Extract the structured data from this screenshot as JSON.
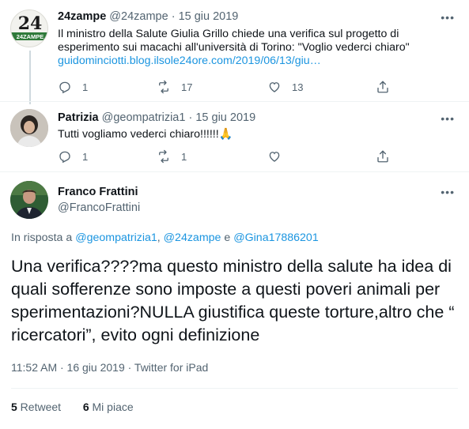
{
  "tweets": [
    {
      "name": "24zampe",
      "handle": "@24zampe",
      "dot": "·",
      "date": "15 giu 2019",
      "text": "Il ministro della Salute Giulia Grillo chiede una verifica sul progetto di esperimento sui macachi all'università di Torino: \"Voglio vederci chiaro\"",
      "link": "guidominciotti.blog.ilsole24ore.com/2019/06/13/giu…",
      "avatar_text": "24ZAMPE",
      "replies": "1",
      "retweets": "17",
      "likes": "13"
    },
    {
      "name": "Patrizia",
      "handle": "@geompatrizia1",
      "dot": "·",
      "date": "15 giu 2019",
      "text": "Tutti vogliamo vederci chiaro!!!!!!🙏",
      "replies": "1",
      "retweets": "1",
      "likes": ""
    }
  ],
  "main": {
    "name": "Franco Frattini",
    "handle": "@FrancoFrattini",
    "reply_prefix": "In risposta a ",
    "mention1": "@geompatrizia1",
    "mention_sep": ", ",
    "mention2": "@24zampe",
    "mention_and": " e ",
    "mention3": "@Gina17886201",
    "text": "Una verifica????ma questo ministro della salute ha idea di quali sofferenze sono imposte a questi poveri animali per sperimentazioni?NULLA giustifica queste torture,altro che “ ricercatori”, evito ogni definizione",
    "meta": "11:52 AM · 16 giu 2019 · Twitter for iPad",
    "retweet_count": "5",
    "retweet_label": " Retweet",
    "like_count": "6",
    "like_label": " Mi piace"
  },
  "more_label": "•••",
  "icons": [
    "reply-icon",
    "retweet-icon",
    "like-icon",
    "share-icon",
    "more-icon"
  ]
}
